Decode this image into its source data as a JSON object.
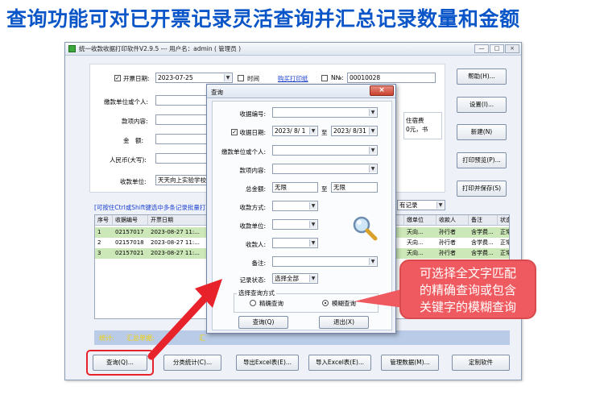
{
  "headline": "查询功能可对已开票记录灵活查询并汇总记录数量和金额",
  "window": {
    "title": "统一收款收据打印软件V2.9.5 --- 用户名：admin ( 管理员 )",
    "controls": [
      "—",
      "□",
      "×"
    ]
  },
  "form": {
    "date_label": "开票日期:",
    "date_checked": "✓",
    "date_value": "2023-07-25",
    "time_label": "时间",
    "buy_paper_link": "购买打印纸",
    "no_label": "N№:",
    "no_value": "00010028",
    "payer_label": "缴款单位或个人:",
    "item_label": "款项内容:",
    "amount_label": "金　额:",
    "rmb_label": "人民币(大写):",
    "receiver_label": "收款单位:",
    "receiver_value": "天天向上实验学校",
    "partial_text_1": "住宿费",
    "partial_text_2": "0元，书"
  },
  "side_buttons": [
    "帮助(H)...",
    "设置(I)...",
    "新建(N)",
    "打印预览(P)...",
    "打印并保存(S)"
  ],
  "hint": "[可按住Ctrl或Shift键选中多条记录批量打印",
  "filter_select": "有记录",
  "table": {
    "headers_left": [
      "序号",
      "收据编号",
      "开票日期"
    ],
    "headers_right": [
      "缴单位",
      "收款人",
      "备注",
      "状态"
    ],
    "rows": [
      {
        "no": "1",
        "code": "02157017",
        "date": "2023-08-27 11:...",
        "unit": "天向...",
        "payee": "孙行者",
        "note": "含学费...",
        "status": "正常"
      },
      {
        "no": "2",
        "code": "02157018",
        "date": "2023-08-27 11:...",
        "unit": "天向...",
        "payee": "孙行者",
        "note": "含学费...",
        "status": "正常"
      },
      {
        "no": "3",
        "code": "02157021",
        "date": "2023-08-27 11:...",
        "unit": "天向...",
        "payee": "孙行者",
        "note": "含学费...",
        "status": "正常"
      }
    ]
  },
  "stats": {
    "label": "统计:",
    "summary": "汇总单据:",
    "extra": "汇"
  },
  "bottom_buttons": [
    "查询(Q)...",
    "分类统计(C)...",
    "导出Excel表(E)...",
    "导入Excel表(E)...",
    "管理数据(M)...",
    "定制软件"
  ],
  "dialog": {
    "title": "查询",
    "close": "×",
    "fields": [
      {
        "label": "收据编号:",
        "type": "select",
        "value": ""
      },
      {
        "label": "收据日期:",
        "type": "daterange",
        "from": "2023/ 8/ 1",
        "to": "2023/ 8/31",
        "sep": "至",
        "checked": "✓"
      },
      {
        "label": "缴款单位或个人:",
        "type": "select",
        "value": ""
      },
      {
        "label": "款项内容:",
        "type": "select",
        "value": ""
      },
      {
        "label": "总金额:",
        "type": "range",
        "from": "无限",
        "to": "无限",
        "sep": "至"
      },
      {
        "label": "收款方式:",
        "type": "shortselect",
        "value": ""
      },
      {
        "label": "收款单位:",
        "type": "shortselect",
        "value": ""
      },
      {
        "label": "收款人:",
        "type": "shortselect",
        "value": ""
      },
      {
        "label": "备注:",
        "type": "select",
        "value": ""
      },
      {
        "label": "记录状态:",
        "type": "shortselect",
        "value": "选择全部"
      }
    ],
    "mode_group": "选择查询方式",
    "mode_exact": "精确查询",
    "mode_fuzzy": "模糊查询",
    "query_button": "查询(Q)",
    "exit_button": "退出(X)"
  },
  "callout": {
    "line1": "可选择全文字匹配",
    "line2": "的精确查询或包含",
    "line3": "关键字的模糊查询"
  },
  "colors": {
    "headline": "#0a55c8",
    "row_green": "#cde8b8",
    "callout": "#ee5a5f",
    "arrow": "#e8222a",
    "stats_text": "#f5d200"
  }
}
